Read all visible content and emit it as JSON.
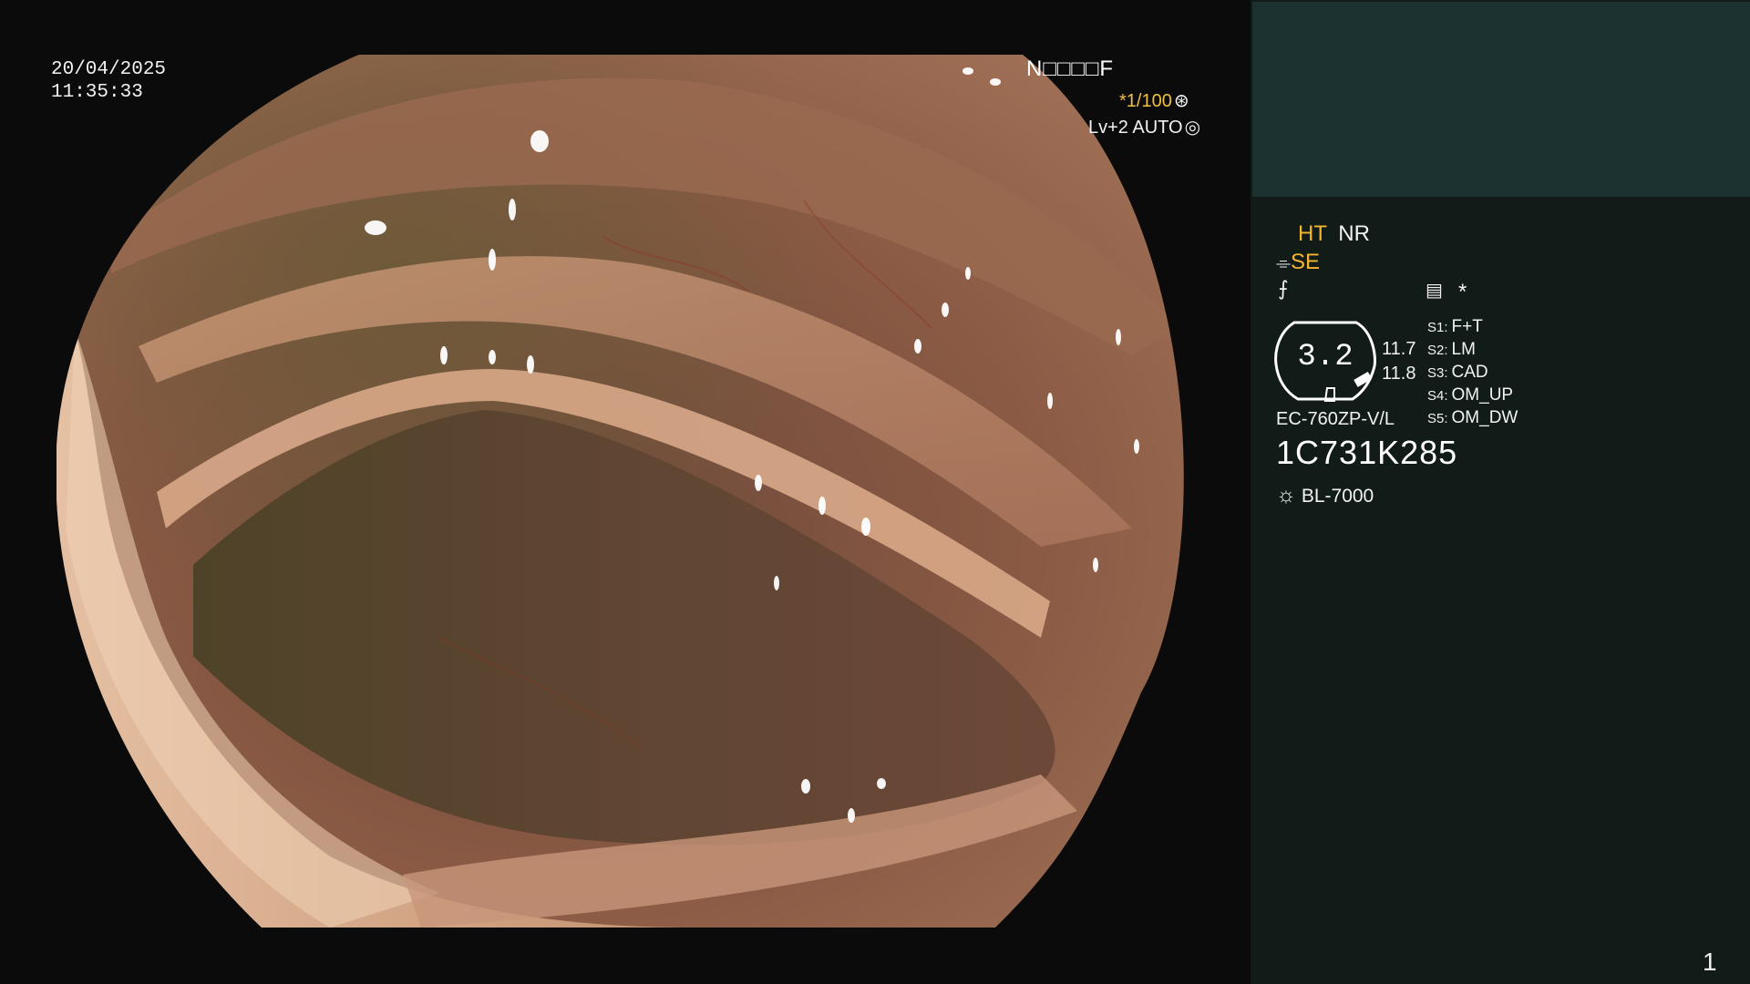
{
  "left_overlay": {
    "date": "20/04/2025",
    "time": "11:35:33",
    "mode_code": "N□□□□F",
    "shutter": "*1/100",
    "shutter_icon": "aperture-icon",
    "level": "Lv+2 AUTO",
    "level_icon": "iris-icon"
  },
  "panel": {
    "ht": "HT",
    "nr": "NR",
    "se": "SE",
    "se_icon": "enhance-icon",
    "curve_icon": "curve-icon",
    "menu_icon": "memo-icon",
    "asterisk": "*",
    "gauge_value": "3.2",
    "gauge_right_1": "11.7",
    "gauge_right_2": "11.8",
    "switches": [
      {
        "key": "S1:",
        "value": "F+T"
      },
      {
        "key": "S2:",
        "value": "LM"
      },
      {
        "key": "S3:",
        "value": "CAD"
      },
      {
        "key": "S4:",
        "value": "OM_UP"
      },
      {
        "key": "S5:",
        "value": "OM_DW"
      }
    ],
    "model": "EC-760ZP-V/L",
    "serial": "1C731K285",
    "light_icon": "sun-icon",
    "light_source": "BL-7000",
    "page_number": "1"
  },
  "colors": {
    "background": "#0b0b0b",
    "panel": "#111c19",
    "panel_top": "#1c3230",
    "accent_orange": "#f5b530",
    "tissue": "#8a5a44"
  }
}
